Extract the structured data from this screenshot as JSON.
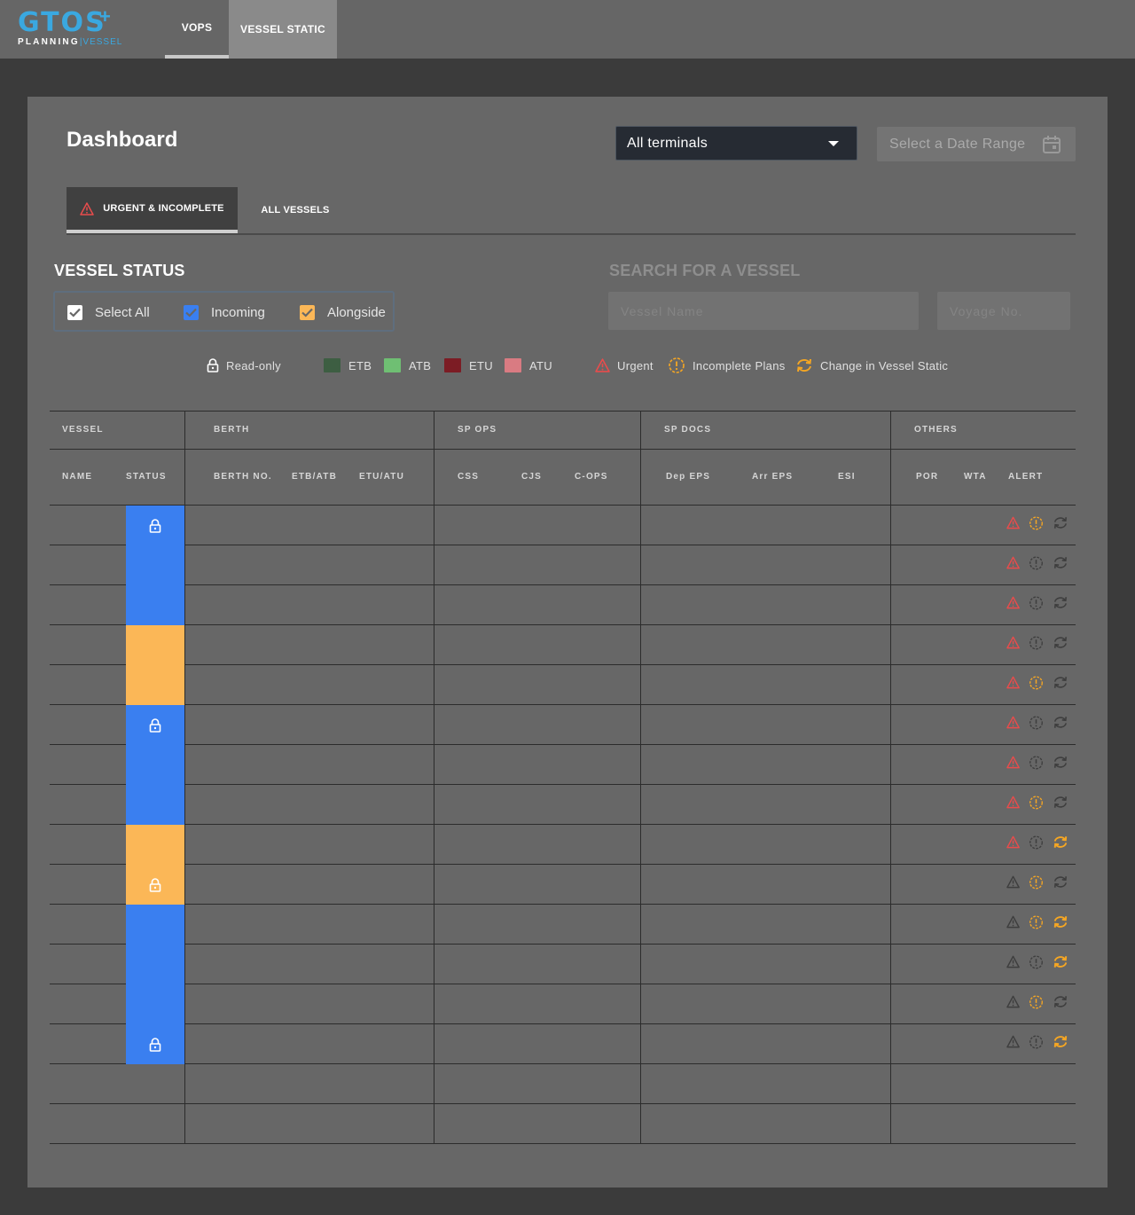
{
  "app": {
    "logo_main": "GTOS",
    "logo_plus": "+",
    "logo_sub_left": "PLANNING",
    "logo_sub_right": "|VESSEL"
  },
  "topnav": [
    {
      "label": "VOPS",
      "active": true
    },
    {
      "label": "VESSEL STATIC",
      "active": false
    }
  ],
  "page": {
    "title": "Dashboard",
    "terminal_select": "All terminals",
    "date_range_placeholder": "Select a Date Range"
  },
  "tabs": [
    {
      "label": "URGENT & INCOMPLETE",
      "active": true,
      "icon": "warning-icon"
    },
    {
      "label": "ALL VESSELS",
      "active": false
    }
  ],
  "vessel_status": {
    "label": "VESSEL STATUS",
    "options": [
      {
        "label": "Select All",
        "checked": true,
        "color": "#ffffff"
      },
      {
        "label": "Incoming",
        "checked": true,
        "color": "#3a7ff0"
      },
      {
        "label": "Alongside",
        "checked": true,
        "color": "#fbb757"
      }
    ]
  },
  "search": {
    "label": "SEARCH FOR A VESSEL",
    "vessel_name_placeholder": "Vessel Name",
    "voyage_placeholder": "Voyage No."
  },
  "legend": {
    "read_only": "Read-only",
    "etb": {
      "label": "ETB",
      "color": "#3d5e42"
    },
    "atb": {
      "label": "ATB",
      "color": "#6fbf73"
    },
    "etu": {
      "label": "ETU",
      "color": "#7c1c24"
    },
    "atu": {
      "label": "ATU",
      "color": "#d97b82"
    },
    "urgent": "Urgent",
    "incomplete": "Incomplete Plans",
    "change": "Change in Vessel Static"
  },
  "table": {
    "groups": [
      "VESSEL",
      "BERTH",
      "SP OPS",
      "SP DOCS",
      "OTHERS"
    ],
    "columns": [
      "NAME",
      "STATUS",
      "BERTH NO.",
      "ETB/ATB",
      "ETU/ATU",
      "CSS",
      "CJS",
      "C-OPS",
      "Dep EPS",
      "Arr EPS",
      "ESI",
      "POR",
      "WTA",
      "ALERT"
    ],
    "rows": [
      {
        "status": "incoming",
        "locked": true,
        "urgent": true,
        "incomplete": true,
        "changed": false
      },
      {
        "status": "incoming",
        "locked": false,
        "urgent": true,
        "incomplete": false,
        "changed": false
      },
      {
        "status": "incoming",
        "locked": false,
        "urgent": true,
        "incomplete": false,
        "changed": false
      },
      {
        "status": "alongside",
        "locked": false,
        "urgent": true,
        "incomplete": false,
        "changed": false
      },
      {
        "status": "alongside",
        "locked": false,
        "urgent": true,
        "incomplete": true,
        "changed": false
      },
      {
        "status": "incoming",
        "locked": true,
        "urgent": true,
        "incomplete": false,
        "changed": false
      },
      {
        "status": "incoming",
        "locked": false,
        "urgent": true,
        "incomplete": false,
        "changed": false
      },
      {
        "status": "incoming",
        "locked": false,
        "urgent": true,
        "incomplete": true,
        "changed": false
      },
      {
        "status": "alongside",
        "locked": false,
        "urgent": true,
        "incomplete": false,
        "changed": true
      },
      {
        "status": "alongside",
        "locked": true,
        "urgent": false,
        "incomplete": true,
        "changed": false
      },
      {
        "status": "incoming",
        "locked": false,
        "urgent": false,
        "incomplete": true,
        "changed": true
      },
      {
        "status": "incoming",
        "locked": false,
        "urgent": false,
        "incomplete": false,
        "changed": true
      },
      {
        "status": "incoming",
        "locked": false,
        "urgent": false,
        "incomplete": true,
        "changed": false
      },
      {
        "status": "incoming",
        "locked": true,
        "urgent": false,
        "incomplete": false,
        "changed": true
      },
      {
        "status": "none",
        "locked": false,
        "urgent": false,
        "incomplete": false,
        "changed": false,
        "empty": true
      },
      {
        "status": "none",
        "locked": false,
        "urgent": false,
        "incomplete": false,
        "changed": false,
        "empty": true
      }
    ]
  },
  "colors": {
    "incoming": "#3a7ff0",
    "alongside": "#fbb757",
    "urgent": "#e84c4c",
    "incomplete": "#f5a623",
    "inactive_icon": "#3e3e3e"
  }
}
